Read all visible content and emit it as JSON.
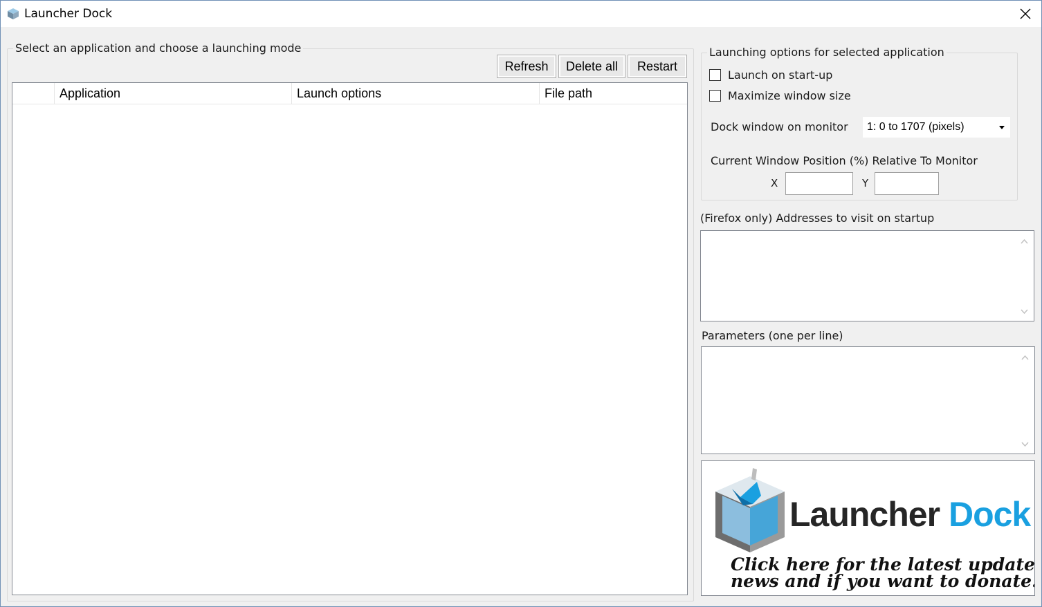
{
  "window": {
    "title": "Launcher Dock"
  },
  "left_panel": {
    "group_label": "Select an application and choose a launching mode",
    "buttons": {
      "refresh": "Refresh",
      "delete_all": "Delete all",
      "restart": "Restart"
    },
    "columns": [
      "",
      "Application",
      "Launch options",
      "File path"
    ],
    "rows": []
  },
  "options": {
    "group_label": "Launching options for selected application",
    "launch_on_startup": {
      "label": "Launch on start-up",
      "checked": false
    },
    "maximize_window": {
      "label": "Maximize window size",
      "checked": false
    },
    "dock_monitor": {
      "label": "Dock window on monitor",
      "selected": "1: 0 to 1707 (pixels)"
    },
    "position": {
      "label": "Current Window Position (%) Relative To Monitor",
      "x_label": "X",
      "y_label": "Y",
      "x_value": "",
      "y_value": ""
    }
  },
  "firefox": {
    "label": "(Firefox only) Addresses to visit on startup",
    "value": ""
  },
  "parameters": {
    "label": "Parameters  (one per line)",
    "value": ""
  },
  "banner": {
    "brand_part1": "Launcher",
    "brand_part2": "Dock",
    "tagline_line1": "Click here for the latest updates,",
    "tagline_line2": "news and if you want to donate."
  },
  "icons": {
    "app": "cube-icon",
    "close": "close-icon",
    "dropdown": "chevron-down-icon",
    "scroll_up": "chevron-up-icon",
    "scroll_down": "chevron-down-icon"
  },
  "colors": {
    "accent": "#1aa0e0",
    "window_bg": "#f0f0f0",
    "border": "#828790"
  }
}
